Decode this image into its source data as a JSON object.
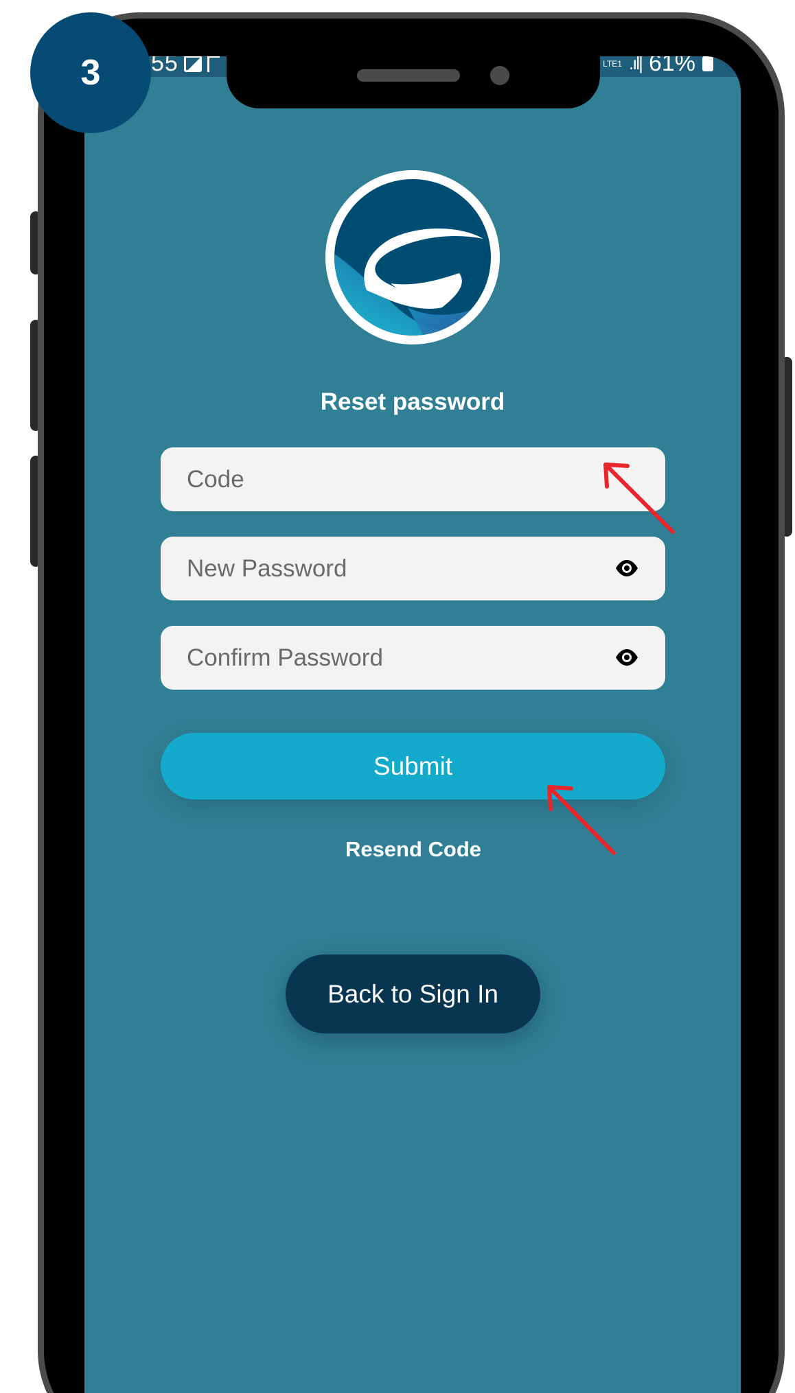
{
  "step_badge": {
    "number": "3"
  },
  "status_bar": {
    "time": "55",
    "battery_percent": "61%",
    "network": "LTE1"
  },
  "logo": {
    "icon": "brand-logo-icon",
    "colors": [
      "#004d73",
      "#1fb4cf",
      "#3e4fa0"
    ]
  },
  "form": {
    "title": "Reset password",
    "code_field": {
      "placeholder": "Code",
      "value": ""
    },
    "new_password_field": {
      "placeholder": "New Password",
      "value": "",
      "icon": "eye-icon"
    },
    "confirm_password_field": {
      "placeholder": "Confirm Password",
      "value": "",
      "icon": "eye-icon"
    },
    "submit_label": "Submit",
    "resend_label": "Resend Code"
  },
  "back_to_signin_label": "Back to Sign In",
  "colors": {
    "screen_background": "#317f94",
    "submit_button": "#13aacb",
    "back_button": "#08354f",
    "step_badge": "#064b73",
    "annotation_arrow": "#e8262b"
  }
}
